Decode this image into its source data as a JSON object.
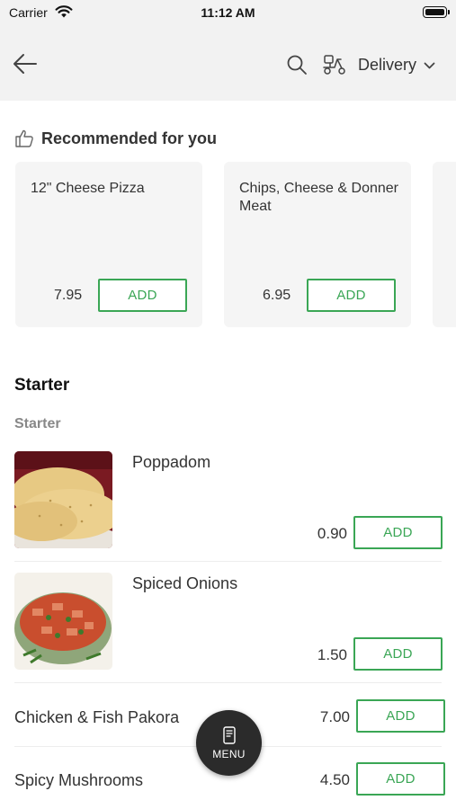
{
  "status_bar": {
    "carrier": "Carrier",
    "time": "11:12 AM"
  },
  "header": {
    "back_icon": "arrow-left-icon",
    "search_icon": "search-icon",
    "delivery_icon": "scooter-icon",
    "delivery_label": "Delivery",
    "dropdown_icon": "chevron-down-icon"
  },
  "recommended": {
    "heading": "Recommended for you",
    "icon": "thumbs-up-icon",
    "items": [
      {
        "name": "12\" Cheese Pizza",
        "price": "7.95",
        "add_label": "ADD"
      },
      {
        "name": "Chips, Cheese & Donner Meat",
        "price": "6.95",
        "add_label": "ADD"
      }
    ]
  },
  "section": {
    "title": "Starter",
    "subtitle": "Starter",
    "items": [
      {
        "name": "Poppadom",
        "price": "0.90",
        "add_label": "ADD"
      },
      {
        "name": "Spiced Onions",
        "price": "1.50",
        "add_label": "ADD"
      },
      {
        "name": "Chicken & Fish Pakora",
        "price": "7.00",
        "add_label": "ADD"
      },
      {
        "name": "Spicy Mushrooms",
        "price": "4.50",
        "add_label": "ADD"
      }
    ]
  },
  "menu_button": {
    "label": "MENU",
    "icon": "menu-book-icon"
  },
  "colors": {
    "accent": "#3aa655",
    "header_bg": "#f2f2f2",
    "fab_bg": "#2b2b2b"
  }
}
